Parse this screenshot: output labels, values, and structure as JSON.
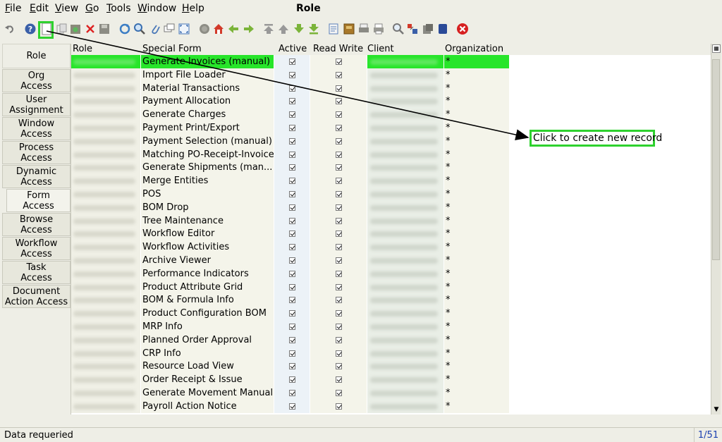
{
  "window": {
    "title": "Role"
  },
  "menu": [
    {
      "label": "File",
      "underline": "F"
    },
    {
      "label": "Edit",
      "underline": "E"
    },
    {
      "label": "View",
      "underline": "V"
    },
    {
      "label": "Go",
      "underline": "G"
    },
    {
      "label": "Tools",
      "underline": "T"
    },
    {
      "label": "Window",
      "underline": "W"
    },
    {
      "label": "Help",
      "underline": "H"
    }
  ],
  "toolbar": {
    "icons": [
      "undo-icon",
      "help-icon",
      "new-record-icon",
      "copy-record-icon",
      "save-icon",
      "delete-icon",
      "save-disk-icon",
      "refresh-icon",
      "find-icon",
      "attachment-icon",
      "chat-icon",
      "grid-toggle-icon",
      "history-icon",
      "home-icon",
      "back-icon",
      "forward-icon",
      "first-record-icon",
      "previous-record-icon",
      "next-record-icon",
      "last-record-icon",
      "report-icon",
      "archive-icon",
      "print-preview-icon",
      "print-icon",
      "zoom-across-icon",
      "request-icon",
      "product-info-icon",
      "workflow-icon",
      "exit-icon"
    ]
  },
  "sidetabs": [
    {
      "label": "Role"
    },
    {
      "label": "Org\nAccess"
    },
    {
      "label": "User\nAssignment"
    },
    {
      "label": "Window\nAccess"
    },
    {
      "label": "Process\nAccess"
    },
    {
      "label": "Dynamic\nAccess"
    },
    {
      "label": "Form\nAccess"
    },
    {
      "label": "Browse\nAccess"
    },
    {
      "label": "Workflow\nAccess"
    },
    {
      "label": "Task\nAccess"
    },
    {
      "label": "Document\nAction Access"
    }
  ],
  "grid": {
    "columns": {
      "role": "Role",
      "form": "Special Form",
      "active": "Active",
      "read_write": "Read Write",
      "client": "Client",
      "org": "Organization"
    },
    "rows": [
      {
        "form": "Generate Invoices (manual)",
        "org": "*"
      },
      {
        "form": "Import File Loader",
        "org": "*"
      },
      {
        "form": "Material Transactions",
        "org": "*"
      },
      {
        "form": "Payment Allocation",
        "org": "*"
      },
      {
        "form": "Generate Charges",
        "org": "*"
      },
      {
        "form": "Payment Print/Export",
        "org": "*"
      },
      {
        "form": "Payment Selection (manual)",
        "org": "*"
      },
      {
        "form": "Matching PO-Receipt-Invoice",
        "org": "*"
      },
      {
        "form": "Generate Shipments (man...",
        "org": "*"
      },
      {
        "form": "Merge Entities",
        "org": "*"
      },
      {
        "form": "POS",
        "org": "*"
      },
      {
        "form": "BOM Drop",
        "org": "*"
      },
      {
        "form": "Tree Maintenance",
        "org": "*"
      },
      {
        "form": "Workflow Editor",
        "org": "*"
      },
      {
        "form": "Workflow Activities",
        "org": "*"
      },
      {
        "form": "Archive Viewer",
        "org": "*"
      },
      {
        "form": "Performance Indicators",
        "org": "*"
      },
      {
        "form": "Product Attribute Grid",
        "org": "*"
      },
      {
        "form": "BOM & Formula Info",
        "org": "*"
      },
      {
        "form": "Product Configuration BOM",
        "org": "*"
      },
      {
        "form": "MRP Info",
        "org": "*"
      },
      {
        "form": "Planned Order Approval",
        "org": "*"
      },
      {
        "form": "CRP Info",
        "org": "*"
      },
      {
        "form": "Resource Load View",
        "org": "*"
      },
      {
        "form": "Order Receipt & Issue",
        "org": "*"
      },
      {
        "form": "Generate Movement Manual",
        "org": "*"
      },
      {
        "form": "Payroll Action Notice",
        "org": "*"
      }
    ]
  },
  "annotation": {
    "text": "Click to create new record"
  },
  "status": {
    "message": "Data requeried",
    "record_count": "1/51"
  },
  "colors": {
    "highlight": "#2ed12e",
    "selection": "#27e52a",
    "record_count": "#1a3fb0"
  }
}
